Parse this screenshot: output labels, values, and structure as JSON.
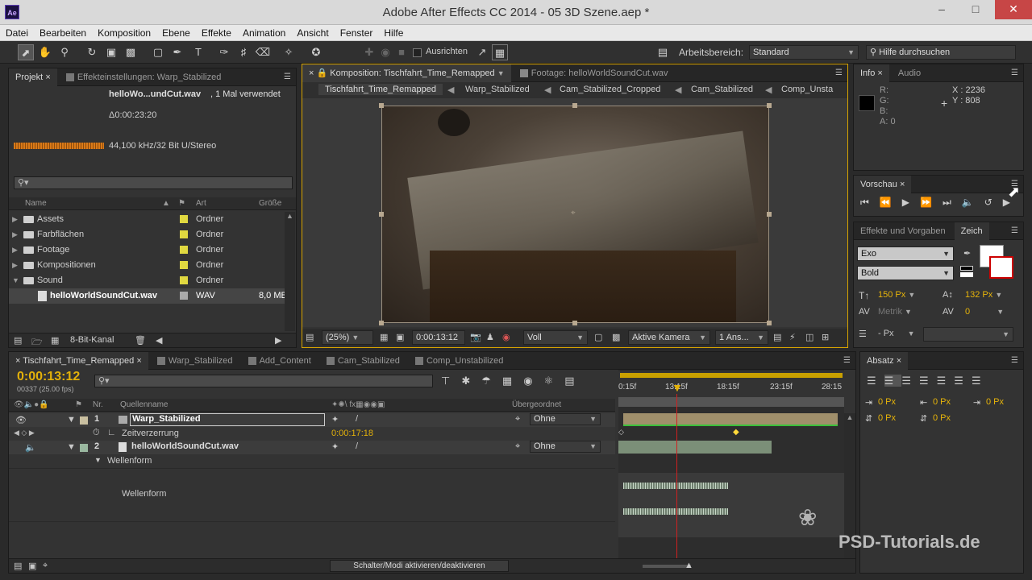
{
  "window": {
    "title": "Adobe After Effects CC 2014 - 05 3D Szene.aep *",
    "app_icon": "Ae"
  },
  "menu": [
    "Datei",
    "Bearbeiten",
    "Komposition",
    "Ebene",
    "Effekte",
    "Animation",
    "Ansicht",
    "Fenster",
    "Hilfe"
  ],
  "toolbar": {
    "snap_label": "Ausrichten",
    "workspace_label": "Arbeitsbereich:",
    "workspace_value": "Standard",
    "help_search_placeholder": "Hilfe durchsuchen"
  },
  "project_panel": {
    "tab_project": "Projekt",
    "tab_effects": "Effekteinstellungen: Warp_Stabilized",
    "item_name": "helloWo...undCut.wav",
    "usage": ", 1 Mal verwendet",
    "duration": "Δ0:00:23:20",
    "audio_info": "44,100 kHz/32 Bit U/Stereo",
    "columns": {
      "name": "Name",
      "type": "Art",
      "size": "Größe"
    },
    "rows": [
      {
        "name": "Assets",
        "type": "Ordner",
        "size": ""
      },
      {
        "name": "Farbflächen",
        "type": "Ordner",
        "size": ""
      },
      {
        "name": "Footage",
        "type": "Ordner",
        "size": ""
      },
      {
        "name": "Kompositionen",
        "type": "Ordner",
        "size": ""
      },
      {
        "name": "Sound",
        "type": "Ordner",
        "size": ""
      },
      {
        "name": "helloWorldSoundCut.wav",
        "type": "WAV",
        "size": "8,0 MB"
      }
    ],
    "bit_depth": "8-Bit-Kanal"
  },
  "comp_panel": {
    "tab_comp": "Komposition: Tischfahrt_Time_Remapped",
    "tab_footage": "Footage: helloWorldSoundCut.wav",
    "breadcrumbs": [
      "Tischfahrt_Time_Remapped",
      "Warp_Stabilized",
      "Cam_Stabilized_Cropped",
      "Cam_Stabilized",
      "Comp_Unsta"
    ],
    "zoom": "(25%)",
    "timecode": "0:00:13:12",
    "quality": "Voll",
    "camera": "Aktive Kamera",
    "views": "1 Ans..."
  },
  "info_panel": {
    "tab_info": "Info",
    "tab_audio": "Audio",
    "r": "R:",
    "g": "G:",
    "b": "B:",
    "a": "A:",
    "a_value": "0",
    "x": "X : 2236",
    "y": "Y : 808"
  },
  "preview_panel": {
    "tab": "Vorschau"
  },
  "effects_panel": {
    "tab_effects": "Effekte und Vorgaben",
    "tab_char": "Zeich"
  },
  "char_panel": {
    "font": "Exo",
    "style": "Bold",
    "size": "150 Px",
    "leading": "132 Px",
    "kerning": "Metrik",
    "tracking": "0",
    "stroke": "- Px"
  },
  "paragraph_panel": {
    "tab": "Absatz",
    "indents": [
      "0 Px",
      "0 Px",
      "0 Px",
      "0 Px",
      "0 Px"
    ]
  },
  "timeline": {
    "tabs": [
      "Tischfahrt_Time_Remapped",
      "Warp_Stabilized",
      "Add_Content",
      "Cam_Stabilized",
      "Comp_Unstabilized"
    ],
    "timecode": "0:00:13:12",
    "frame_info": "00337 (25.00 fps)",
    "col_nr": "Nr.",
    "col_source": "Quellenname",
    "col_parent": "Übergeordnet",
    "ruler": [
      "0:15f",
      "13:15f",
      "18:15f",
      "23:15f",
      "28:15"
    ],
    "layers": [
      {
        "nr": "1",
        "name": "Warp_Stabilized",
        "parent": "Ohne"
      },
      {
        "nr": "2",
        "name": "helloWorldSoundCut.wav",
        "parent": "Ohne"
      }
    ],
    "time_remap_label": "Zeitverzerrung",
    "time_remap_value": "0:00:17:18",
    "waveform_label": "Wellenform",
    "waveform_sub": "Wellenform",
    "toggle_label": "Schalter/Modi aktivieren/deaktivieren"
  },
  "watermark": "PSD-Tutorials.de"
}
